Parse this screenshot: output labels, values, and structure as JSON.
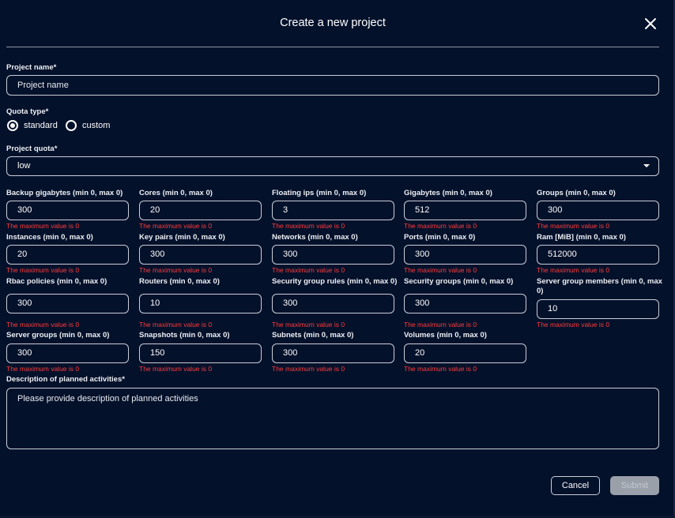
{
  "dialog": {
    "title": "Create a new project",
    "close_icon": "close-icon"
  },
  "project_name": {
    "label": "Project name*",
    "placeholder": "Project name"
  },
  "quota_type": {
    "label": "Quota type*",
    "options": [
      {
        "label": "standard",
        "selected": true
      },
      {
        "label": "custom",
        "selected": false
      }
    ]
  },
  "project_quota": {
    "label": "Project quota*",
    "value": "low",
    "arrow_icon": "caret-down-icon"
  },
  "quota_error": "The maximum value is 0",
  "quotas": [
    {
      "label": "Backup gigabytes (min 0, max 0)",
      "value": "300"
    },
    {
      "label": "Cores (min 0, max 0)",
      "value": "20"
    },
    {
      "label": "Floating ips (min 0, max 0)",
      "value": "3"
    },
    {
      "label": "Gigabytes (min 0, max 0)",
      "value": "512"
    },
    {
      "label": "Groups (min 0, max 0)",
      "value": "300"
    },
    {
      "label": "Instances (min 0, max 0)",
      "value": "20"
    },
    {
      "label": "Key pairs (min 0, max 0)",
      "value": "300"
    },
    {
      "label": "Networks (min 0, max 0)",
      "value": "300"
    },
    {
      "label": "Ports (min 0, max 0)",
      "value": "300"
    },
    {
      "label": "Ram [MiB] (min 0, max 0)",
      "value": "512000"
    },
    {
      "label": "Rbac policies (min 0, max 0)",
      "value": "300"
    },
    {
      "label": "Routers (min 0, max 0)",
      "value": "10"
    },
    {
      "label": "Security group rules (min 0, max 0)",
      "value": "300"
    },
    {
      "label": "Security groups (min 0, max 0)",
      "value": "300"
    },
    {
      "label": "Server group members (min 0, max 0)",
      "value": "10"
    },
    {
      "label": "Server groups (min 0, max 0)",
      "value": "300"
    },
    {
      "label": "Snapshots (min 0, max 0)",
      "value": "150"
    },
    {
      "label": "Subnets (min 0, max 0)",
      "value": "300"
    },
    {
      "label": "Volumes (min 0, max 0)",
      "value": "20"
    }
  ],
  "description": {
    "label": "Description of planned activities*",
    "placeholder": "Please provide description of planned activities"
  },
  "actions": {
    "cancel": "Cancel",
    "submit": "Submit"
  },
  "colors": {
    "background": "#04112b",
    "error": "#ff3b3b",
    "border": "#c9ced7",
    "submit_disabled": "#9aa0aa"
  }
}
